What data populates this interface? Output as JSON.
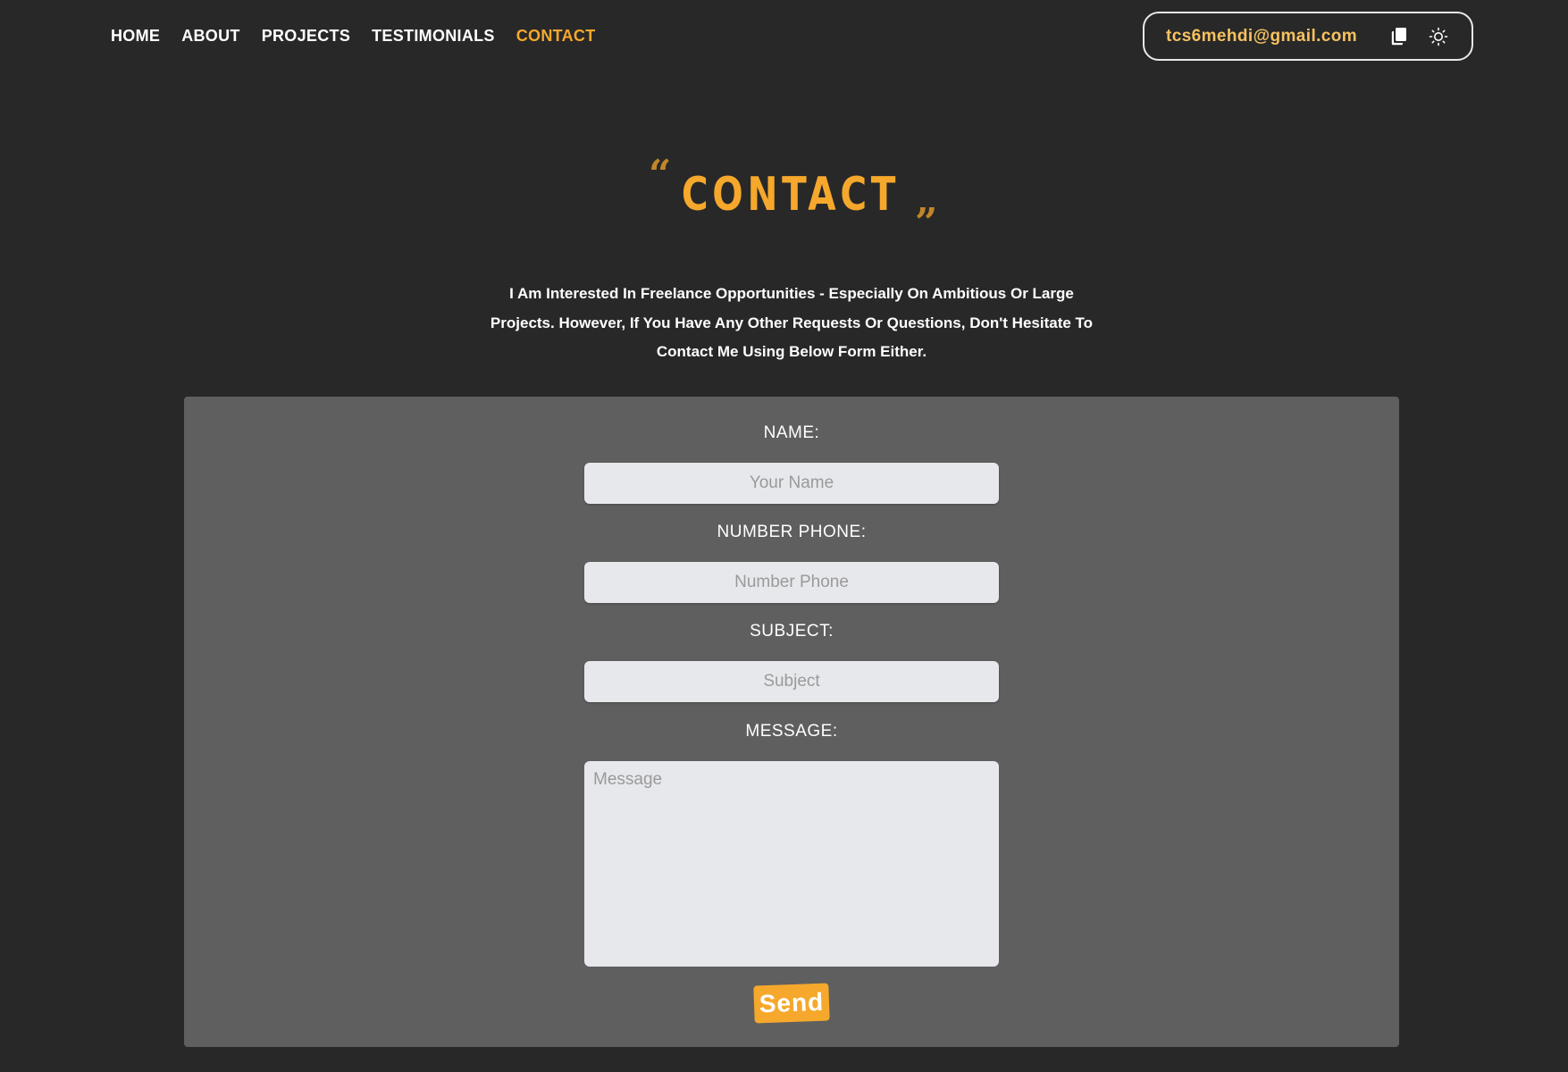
{
  "nav": {
    "items": [
      {
        "label": "HOME"
      },
      {
        "label": "ABOUT"
      },
      {
        "label": "PROJECTS"
      },
      {
        "label": "TESTIMONIALS"
      },
      {
        "label": "CONTACT",
        "active": true
      }
    ]
  },
  "header": {
    "email": "tcs6mehdi@gmail.com",
    "icons": [
      "copy-icon",
      "sun-icon"
    ]
  },
  "section": {
    "quote_open": "“",
    "title": "CONTACT",
    "quote_close": "”",
    "intro": "I Am Interested In Freelance Opportunities - Especially On Ambitious Or Large Projects. However, If You Have Any Other Requests Or Questions, Don't Hesitate To Contact Me Using Below Form Either."
  },
  "form": {
    "name_label": "NAME:",
    "name_placeholder": "Your Name",
    "phone_label": "NUMBER PHONE:",
    "phone_placeholder": "Number Phone",
    "subject_label": "SUBJECT:",
    "subject_placeholder": "Subject",
    "message_label": "MESSAGE:",
    "message_placeholder": "Message",
    "send_label": "Send"
  },
  "colors": {
    "background": "#282828",
    "panel": "#5f5f5f",
    "accent": "#f6a82c",
    "field": "#e7e8ec"
  }
}
